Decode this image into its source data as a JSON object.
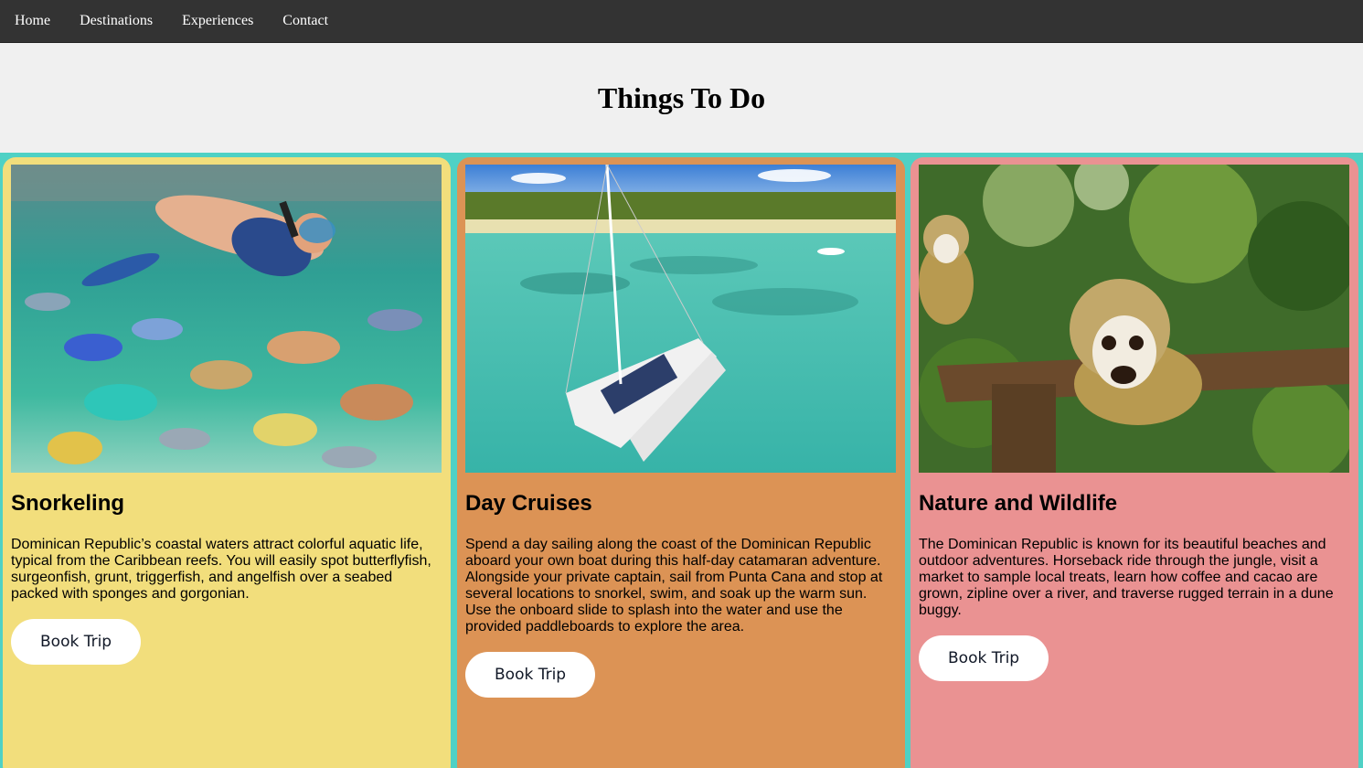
{
  "nav": {
    "items": [
      {
        "label": "Home"
      },
      {
        "label": "Destinations"
      },
      {
        "label": "Experiences"
      },
      {
        "label": "Contact"
      }
    ]
  },
  "hero": {
    "title": "Things To Do"
  },
  "cards": [
    {
      "title": "Snorkeling",
      "text": "Dominican Republic’s coastal waters attract colorful aquatic life, typical from the Caribbean reefs. You will easily spot butterflyfish, surgeonfish, grunt, triggerfish, and angelfish over a seabed packed with sponges and gorgonian.",
      "button": "Book Trip",
      "bg_color": "#f2de7c",
      "image": "snorkeler-with-tropical-fish-photo"
    },
    {
      "title": "Day Cruises",
      "text": "Spend a day sailing along the coast of the Dominican Republic aboard your own boat during this half-day catamaran adventure. Alongside your private captain, sail from Punta Cana and stop at several locations to snorkel, swim, and soak up the warm sun. Use the onboard slide to splash into the water and use the provided paddleboards to explore the area.",
      "button": "Book Trip",
      "bg_color": "#dc9355",
      "image": "catamaran-in-turquoise-lagoon-photo"
    },
    {
      "title": "Nature and Wildlife",
      "text": "The Dominican Republic is known for its beautiful beaches and outdoor adventures. Horseback ride through the jungle, visit a market to sample local treats, learn how coffee and cacao are grown, zipline over a river, and traverse rugged terrain in a dune buggy.",
      "button": "Book Trip",
      "bg_color": "#ea9292",
      "image": "squirrel-monkeys-on-branch-photo"
    }
  ],
  "colors": {
    "nav_bg": "#333333",
    "hero_bg": "#f0f0f0",
    "page_accent": "#4fd1c5",
    "button_bg": "#ffffff"
  }
}
